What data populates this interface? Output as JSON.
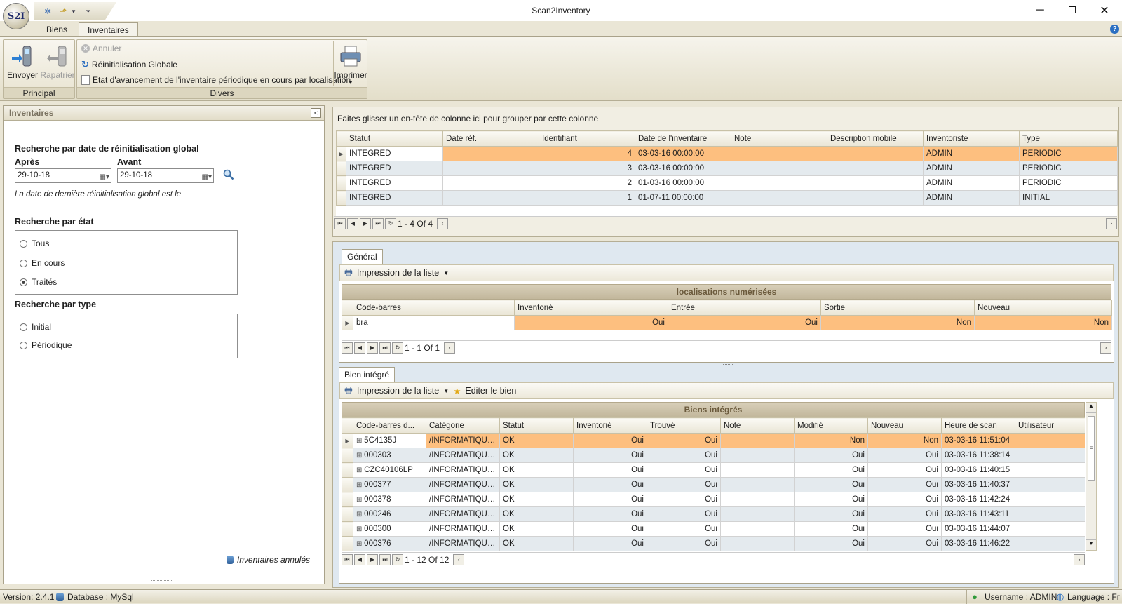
{
  "window": {
    "title": "Scan2Inventory",
    "logo_text": "S2I"
  },
  "ribbon_tabs": [
    "Biens",
    "Inventaires"
  ],
  "ribbon": {
    "envoyer": "Envoyer",
    "rapatrier": "Rapatrier",
    "principal": "Principal",
    "annuler": "Annuler",
    "reinit": "Réinitialisation Globale",
    "etat": "Etat d'avancement de l'inventaire périodique  en cours par localisation",
    "divers": "Divers",
    "imprimer": "Imprimer"
  },
  "left_panel": {
    "title": "Inventaires",
    "search_date_title": "Recherche par date de réinitialisation global",
    "apres_label": "Après",
    "avant_label": "Avant",
    "apres_value": "29-10-18",
    "avant_value": "29-10-18",
    "note": "La date de dernière réinitialisation global est le",
    "etat_title": "Recherche par état",
    "etat_options": [
      "Tous",
      "En cours",
      "Traités"
    ],
    "type_title": "Recherche par type",
    "type_options": [
      "Initial",
      "Périodique"
    ],
    "cancelled_link": "Inventaires annulés"
  },
  "inventory_grid": {
    "group_hint": "Faites glisser un en-tête de colonne ici pour grouper par cette colonne",
    "columns": [
      "Statut",
      "Date réf.",
      "Identifiant",
      "Date de l'inventaire",
      "Note",
      "Description mobile",
      "Inventoriste",
      "Type"
    ],
    "rows": [
      [
        "INTEGRED",
        "",
        "4",
        "03-03-16 00:00:00",
        "",
        "",
        "ADMIN",
        "PERIODIC"
      ],
      [
        "INTEGRED",
        "",
        "3",
        "03-03-16 00:00:00",
        "",
        "",
        "ADMIN",
        "PERIODIC"
      ],
      [
        "INTEGRED",
        "",
        "2",
        "01-03-16 00:00:00",
        "",
        "",
        "ADMIN",
        "PERIODIC"
      ],
      [
        "INTEGRED",
        "",
        "1",
        "01-07-11 00:00:00",
        "",
        "",
        "ADMIN",
        "INITIAL"
      ]
    ],
    "pager": "1 - 4 Of 4"
  },
  "general": {
    "tab": "Général",
    "print_list": "Impression de la liste",
    "band": "localisations numérisées",
    "columns": [
      "Code-barres",
      "Inventorié",
      "Entrée",
      "Sortie",
      "Nouveau"
    ],
    "rows": [
      [
        "bra",
        "Oui",
        "Oui",
        "Non",
        "Non"
      ]
    ],
    "pager": "1 - 1 Of 1"
  },
  "integrated": {
    "tab": "Bien intégré",
    "print_list": "Impression de la liste",
    "edit": "Editer le bien",
    "band": "Biens intégrés",
    "columns": [
      "Code-barres d...",
      "Catégorie",
      "Statut",
      "Inventorié",
      "Trouvé",
      "Note",
      "Modifié",
      "Nouveau",
      "Heure de scan",
      "Utilisateur"
    ],
    "rows": [
      [
        "5C4135J",
        "/INFORMATIQUE/...",
        "OK",
        "Oui",
        "Oui",
        "",
        "Non",
        "Non",
        "03-03-16 11:51:04",
        ""
      ],
      [
        "000303",
        "/INFORMATIQUE/...",
        "OK",
        "Oui",
        "Oui",
        "",
        "Oui",
        "Oui",
        "03-03-16 11:38:14",
        ""
      ],
      [
        "CZC40106LP",
        "/INFORMATIQUE/...",
        "OK",
        "Oui",
        "Oui",
        "",
        "Oui",
        "Oui",
        "03-03-16 11:40:15",
        ""
      ],
      [
        "000377",
        "/INFORMATIQUE/...",
        "OK",
        "Oui",
        "Oui",
        "",
        "Oui",
        "Oui",
        "03-03-16 11:40:37",
        ""
      ],
      [
        "000378",
        "/INFORMATIQUE/...",
        "OK",
        "Oui",
        "Oui",
        "",
        "Oui",
        "Oui",
        "03-03-16 11:42:24",
        ""
      ],
      [
        "000246",
        "/INFORMATIQUE/...",
        "OK",
        "Oui",
        "Oui",
        "",
        "Oui",
        "Oui",
        "03-03-16 11:43:11",
        ""
      ],
      [
        "000300",
        "/INFORMATIQUE/...",
        "OK",
        "Oui",
        "Oui",
        "",
        "Oui",
        "Oui",
        "03-03-16 11:44:07",
        ""
      ],
      [
        "000376",
        "/INFORMATIQUE/...",
        "OK",
        "Oui",
        "Oui",
        "",
        "Oui",
        "Oui",
        "03-03-16 11:46:22",
        ""
      ]
    ],
    "pager": "1 - 12 Of 12"
  },
  "status": {
    "version": "Version: 2.4.1",
    "database": "Database : MySql",
    "username": "Username : ADMIN",
    "language": "Language : Fr"
  },
  "colors": {
    "selected_row": "#fdbf7f",
    "alt_row": "#e4eaee",
    "chrome": "#eae6d6"
  },
  "icons": [
    "settings-icon",
    "export-icon",
    "scanner-send-icon",
    "scanner-receive-icon",
    "cancel-icon",
    "refresh-icon",
    "printer-icon",
    "search-icon",
    "database-icon",
    "user-icon",
    "globe-icon",
    "star-icon",
    "help-icon"
  ]
}
